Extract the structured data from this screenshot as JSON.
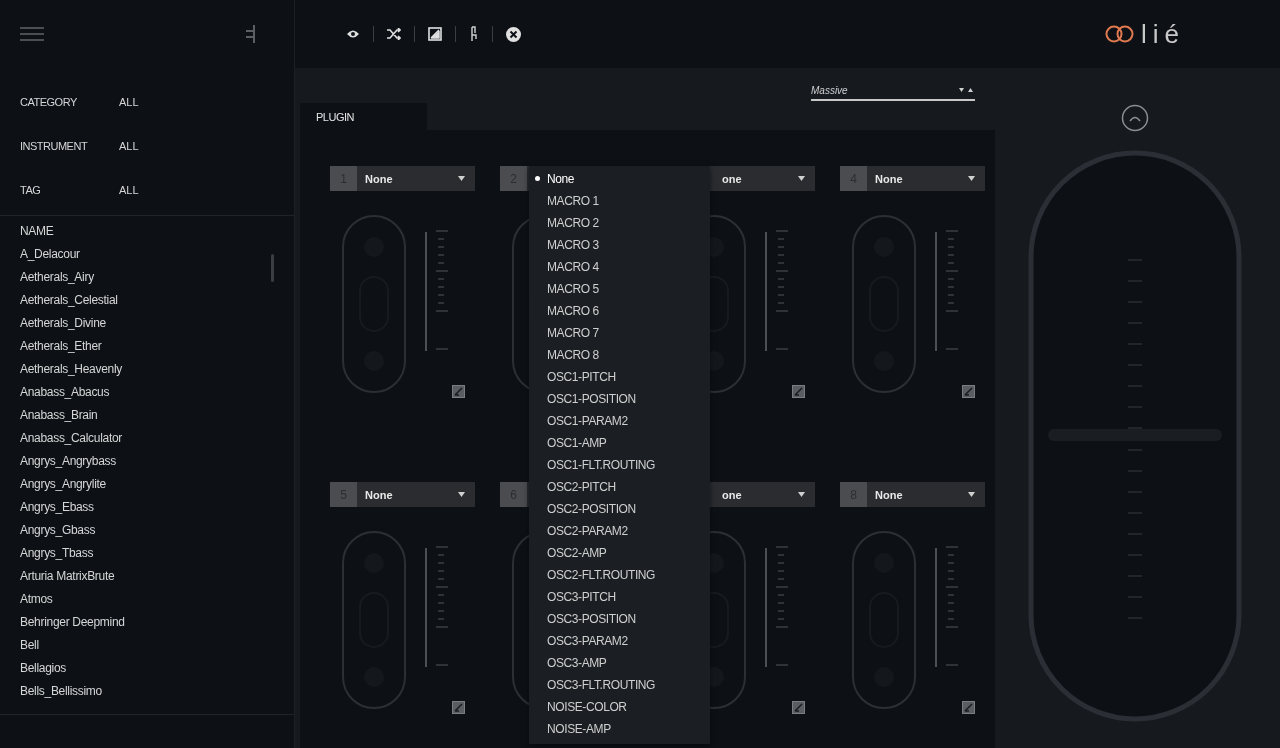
{
  "sidebar": {
    "filters": [
      {
        "label": "CATEGORY",
        "value": "ALL"
      },
      {
        "label": "INSTRUMENT",
        "value": "ALL"
      },
      {
        "label": "TAG",
        "value": "ALL"
      }
    ],
    "list": {
      "heading": "NAME",
      "items": [
        "A_Delacour",
        "Aetherals_Airy",
        "Aetherals_Celestial",
        "Aetherals_Divine",
        "Aetherals_Ether",
        "Aetherals_Heavenly",
        "Anabass_Abacus",
        "Anabass_Brain",
        "Anabass_Calculator",
        "Angrys_Angrybass",
        "Angrys_Angrylite",
        "Angrys_Ebass",
        "Angrys_Gbass",
        "Angrys_Tbass",
        "Arturia MatrixBrute",
        "Atmos",
        "Behringer Deepmind",
        "Bell",
        "Bellagios",
        "Bells_Bellissimo"
      ]
    }
  },
  "logo": {
    "text": "lié"
  },
  "preset_select": {
    "value": "Massive"
  },
  "tabs": [
    {
      "label": "PLUGIN",
      "selected": true
    }
  ],
  "slots": [
    {
      "number": "1",
      "value": "None"
    },
    {
      "number": "2"
    },
    {
      "value": "one"
    },
    {
      "number": "4",
      "value": "None"
    },
    {
      "number": "5",
      "value": "None"
    },
    {
      "number": "6"
    },
    {
      "value": "one"
    },
    {
      "number": "8",
      "value": "None"
    }
  ],
  "menu": {
    "items": [
      {
        "label": "None",
        "selected": true
      },
      {
        "label": "MACRO 1",
        "selected": false
      },
      {
        "label": "MACRO 2",
        "selected": false
      },
      {
        "label": "MACRO 3",
        "selected": false
      },
      {
        "label": "MACRO 4",
        "selected": false
      },
      {
        "label": "MACRO 5",
        "selected": false
      },
      {
        "label": "MACRO 6",
        "selected": false
      },
      {
        "label": "MACRO 7",
        "selected": false
      },
      {
        "label": "MACRO 8",
        "selected": false
      },
      {
        "label": "OSC1-PITCH",
        "selected": false
      },
      {
        "label": "OSC1-POSITION",
        "selected": false
      },
      {
        "label": "OSC1-PARAM2",
        "selected": false
      },
      {
        "label": "OSC1-AMP",
        "selected": false
      },
      {
        "label": "OSC1-FLT.ROUTING",
        "selected": false
      },
      {
        "label": "OSC2-PITCH",
        "selected": false
      },
      {
        "label": "OSC2-POSITION",
        "selected": false
      },
      {
        "label": "OSC2-PARAM2",
        "selected": false
      },
      {
        "label": "OSC2-AMP",
        "selected": false
      },
      {
        "label": "OSC2-FLT.ROUTING",
        "selected": false
      },
      {
        "label": "OSC3-PITCH",
        "selected": false
      },
      {
        "label": "OSC3-POSITION",
        "selected": false
      },
      {
        "label": "OSC3-PARAM2",
        "selected": false
      },
      {
        "label": "OSC3-AMP",
        "selected": false
      },
      {
        "label": "OSC3-FLT.ROUTING",
        "selected": false
      },
      {
        "label": "NOISE-COLOR",
        "selected": false
      },
      {
        "label": "NOISE-AMP",
        "selected": false
      }
    ]
  }
}
